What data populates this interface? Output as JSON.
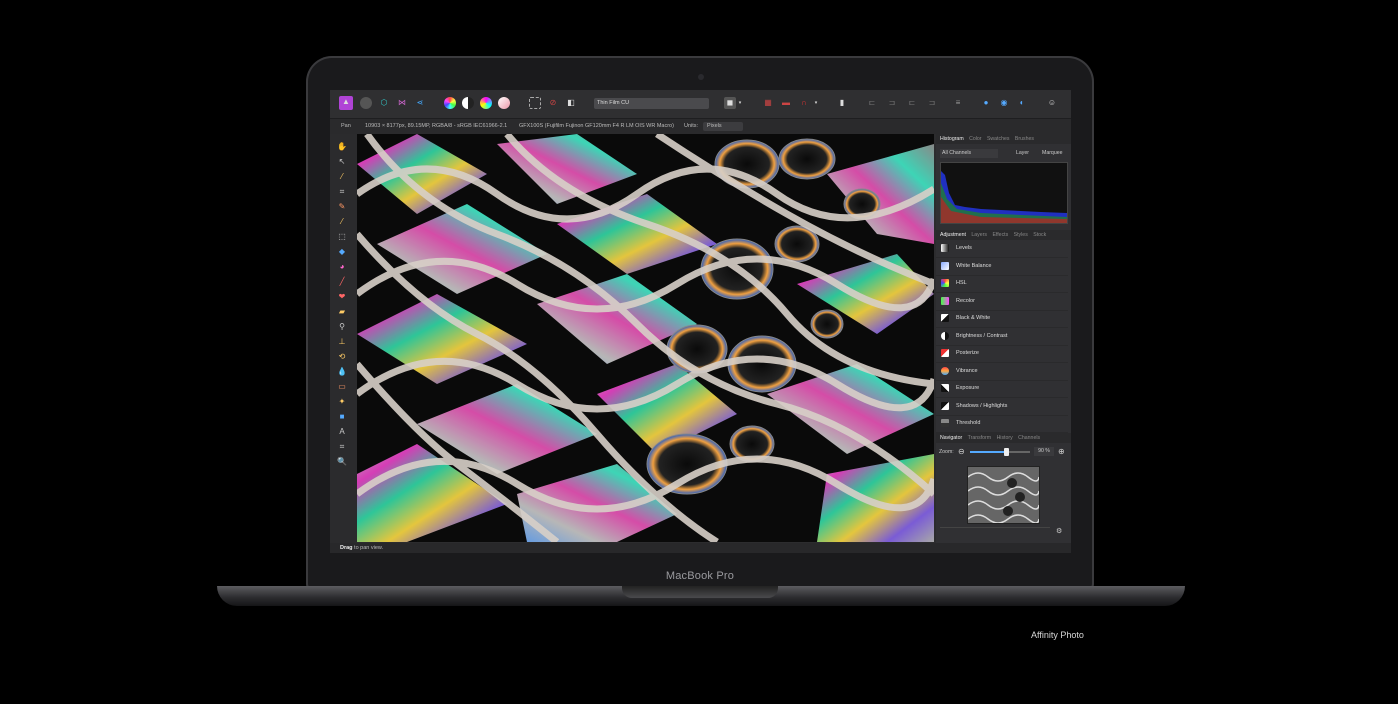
{
  "device": {
    "bezel_label": "MacBook Pro",
    "caption": "Affinity Photo"
  },
  "toolbar": {
    "document_name": "Thin Film CU"
  },
  "context_bar": {
    "tool": "Pan",
    "image_info": "10903 × 8177px, 89.15MP, RGBA/8 - sRGB IEC61966-2.1",
    "camera_info": "GFX100S (Fujifilm Fujinon GF120mm F4 R LM OIS WR Macro)",
    "units_label": "Units:",
    "units_value": "Pixels"
  },
  "status_bar": {
    "drag_word": "Drag",
    "hint": " to pan view."
  },
  "histogram_panel": {
    "tabs": [
      "Histogram",
      "Color",
      "Swatches",
      "Brushes"
    ],
    "channel_select": "All Channels",
    "layer_option": "Layer",
    "marquee_option": "Marquee"
  },
  "adjustment_panel": {
    "tabs": [
      "Adjustment",
      "Layers",
      "Effects",
      "Styles",
      "Stock"
    ],
    "items": [
      {
        "label": "Levels",
        "icon": "levels-icon"
      },
      {
        "label": "White Balance",
        "icon": "white-balance-icon"
      },
      {
        "label": "HSL",
        "icon": "hsl-icon"
      },
      {
        "label": "Recolor",
        "icon": "recolor-icon"
      },
      {
        "label": "Black & White",
        "icon": "black-white-icon"
      },
      {
        "label": "Brightness / Contrast",
        "icon": "brightness-contrast-icon"
      },
      {
        "label": "Posterize",
        "icon": "posterize-icon"
      },
      {
        "label": "Vibrance",
        "icon": "vibrance-icon"
      },
      {
        "label": "Exposure",
        "icon": "exposure-icon"
      },
      {
        "label": "Shadows / Highlights",
        "icon": "shadows-highlights-icon"
      },
      {
        "label": "Threshold",
        "icon": "threshold-icon"
      }
    ]
  },
  "navigator_panel": {
    "tabs": [
      "Navigator",
      "Transform",
      "History",
      "Channels"
    ],
    "zoom_label": "Zoom:",
    "zoom_value": "90 %",
    "zoom_fraction": 0.6
  },
  "colors": {
    "accent": "#b043d6",
    "background": "#000000"
  }
}
